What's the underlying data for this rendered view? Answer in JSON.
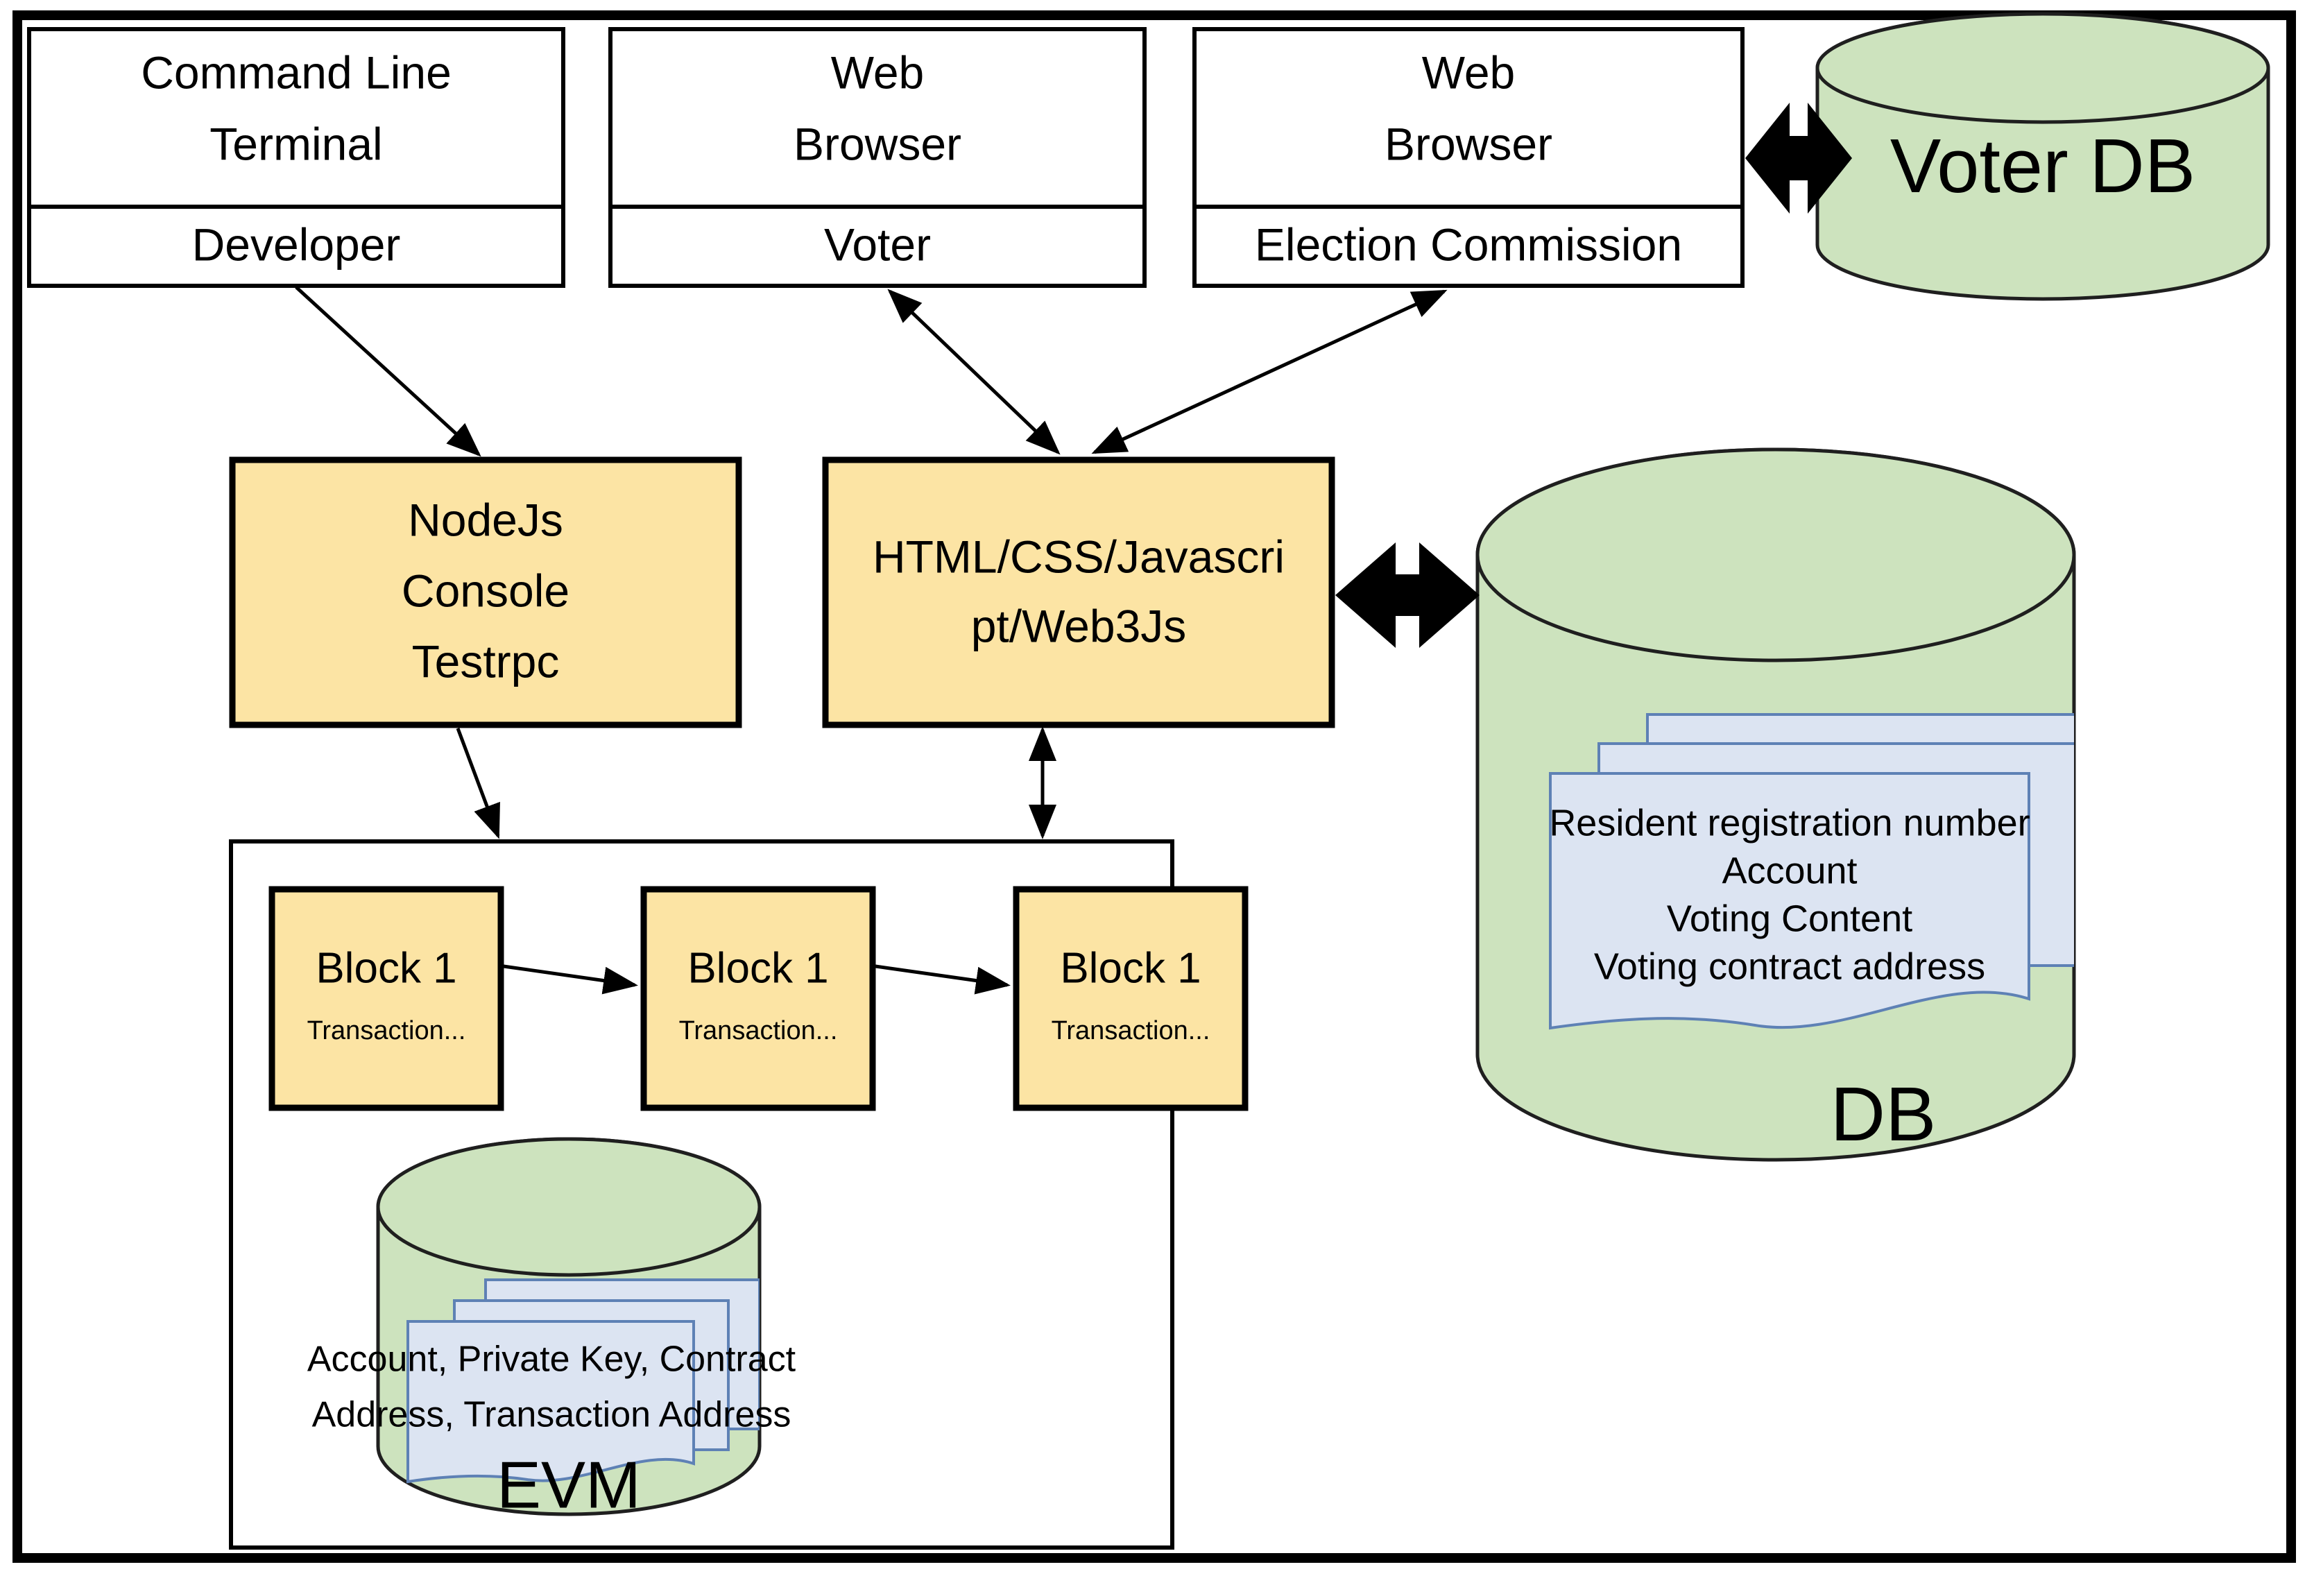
{
  "diagram": {
    "title": "Blockchain E-Voting System Architecture",
    "colors": {
      "component_fill": "#FCE4A4",
      "database_fill": "#CDE3BE",
      "document_fill": "#DCE4F2",
      "document_stroke": "#5E81B5",
      "stroke": "#000000",
      "background": "#FFFFFF"
    },
    "clients": [
      {
        "id": "cmd-terminal",
        "interface": "Command Line\nTerminal",
        "interface_line1": "Command Line",
        "interface_line2": "Terminal",
        "actor": "Developer"
      },
      {
        "id": "web-browser-voter",
        "interface": "Web\nBrowser",
        "interface_line1": "Web",
        "interface_line2": "Browser",
        "actor": "Voter"
      },
      {
        "id": "web-browser-ec",
        "interface": "Web\nBrowser",
        "interface_line1": "Web",
        "interface_line2": "Browser",
        "actor": "Election Commission"
      }
    ],
    "voter_db": {
      "label": "Voter DB"
    },
    "middle_tier": [
      {
        "id": "nodejs-console",
        "line1": "NodeJs",
        "line2": "Console",
        "line3": "Testrpc"
      },
      {
        "id": "web-frontend",
        "line1": "HTML/CSS/Javascri",
        "line2": "pt/Web3Js"
      }
    ],
    "blockchain": {
      "container_label": "EVM",
      "blocks": [
        {
          "title": "Block 1",
          "subtitle": "Transaction..."
        },
        {
          "title": "Block 1",
          "subtitle": "Transaction..."
        },
        {
          "title": "Block 1",
          "subtitle": "Transaction..."
        }
      ],
      "evm_store": {
        "label": "EVM",
        "document_lines": [
          "Account, Private Key, Contract",
          "Address, Transaction Address"
        ]
      }
    },
    "main_db": {
      "label": "DB",
      "document_lines": [
        "Resident registration number",
        "Account",
        "Voting Content",
        "Voting contract address"
      ]
    },
    "connectors": [
      {
        "id": "developer-to-nodejs",
        "from": "Developer",
        "to": "NodeJs Console Testrpc",
        "style": "single-arrow"
      },
      {
        "id": "voter-to-frontend",
        "from": "Voter",
        "to": "HTML/CSS/Javascript/Web3Js",
        "style": "double-arrow"
      },
      {
        "id": "ec-to-frontend",
        "from": "Election Commission",
        "to": "HTML/CSS/Javascript/Web3Js",
        "style": "double-arrow"
      },
      {
        "id": "ec-to-voterdb",
        "from": "Web Browser (Election Commission)",
        "to": "Voter DB",
        "style": "block-double-arrow"
      },
      {
        "id": "frontend-to-db",
        "from": "HTML/CSS/Javascript/Web3Js",
        "to": "DB",
        "style": "block-double-arrow"
      },
      {
        "id": "frontend-to-evm",
        "from": "HTML/CSS/Javascript/Web3Js",
        "to": "EVM",
        "style": "double-arrow"
      },
      {
        "id": "nodejs-to-evm",
        "from": "NodeJs Console Testrpc",
        "to": "EVM",
        "style": "single-arrow"
      },
      {
        "id": "block1-to-block2",
        "from": "Block 1",
        "to": "Block 1",
        "style": "single-arrow"
      },
      {
        "id": "block2-to-block3",
        "from": "Block 1",
        "to": "Block 1",
        "style": "single-arrow"
      }
    ]
  }
}
